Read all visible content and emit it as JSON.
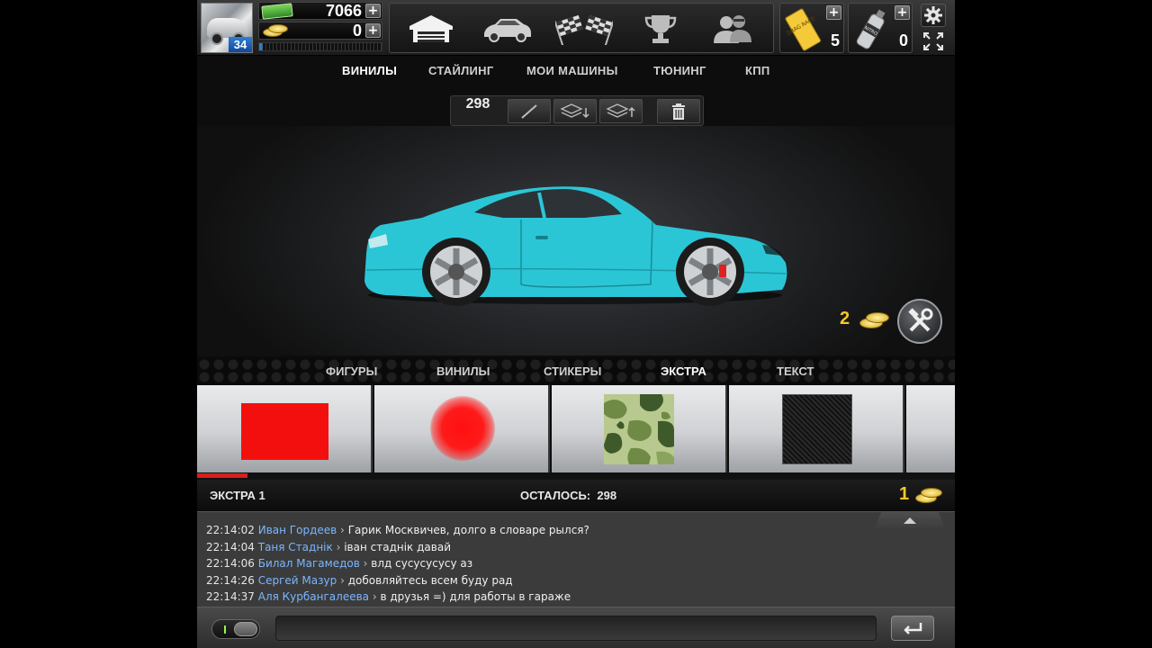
{
  "player": {
    "level": "34",
    "cash": "7066",
    "gold": "0",
    "xp_fraction": 0.03
  },
  "top_nav": [
    {
      "icon": "garage-icon"
    },
    {
      "icon": "car-icon"
    },
    {
      "icon": "race-flags-icon"
    },
    {
      "icon": "trophy-icon"
    },
    {
      "icon": "friends-icon"
    }
  ],
  "resources": {
    "tickets": "5",
    "nitro": "0",
    "ticket_label": "DRAG RACE",
    "nitro_label": "NITRO"
  },
  "main_tabs": [
    {
      "label": "ВИНИЛЫ",
      "active": true
    },
    {
      "label": "СТАЙЛИНГ",
      "active": false
    },
    {
      "label": "МОИ МАШИНЫ",
      "active": false
    },
    {
      "label": "ТЮНИНГ",
      "active": false
    },
    {
      "label": "КПП",
      "active": false
    }
  ],
  "toolbar": {
    "count": "298",
    "tools": [
      "brush-icon",
      "layer-down-icon",
      "layer-up-icon",
      "trash-icon"
    ]
  },
  "stage": {
    "car_color": "#2bc6d6",
    "price": "2"
  },
  "sub_tabs": [
    {
      "label": "ФИГУРЫ",
      "active": false
    },
    {
      "label": "ВИНИЛЫ",
      "active": false
    },
    {
      "label": "СТИКЕРЫ",
      "active": false
    },
    {
      "label": "ЭКСТРА",
      "active": true
    },
    {
      "label": "ТЕКСТ",
      "active": false
    }
  ],
  "carousel": {
    "items": [
      "red-square",
      "red-blur-circle",
      "camo-pattern",
      "carbon-pattern"
    ],
    "scroll_fraction": 0.066
  },
  "info_bar": {
    "selected": "ЭКСТРА 1",
    "remaining": "ОСТАЛОСЬ:  298",
    "price": "1"
  },
  "chat": {
    "messages": [
      {
        "time": "22:14:02",
        "name": "Иван Гордеев",
        "text": "Гарик Москвичев, долго в словаре рылся?"
      },
      {
        "time": "22:14:04",
        "name": "Таня Стаднік",
        "text": "іван стаднік давай"
      },
      {
        "time": "22:14:06",
        "name": "Билал Магамедов",
        "text": "влд сусусусусу аз"
      },
      {
        "time": "22:14:26",
        "name": "Сергей Мазур",
        "text": "добовляйтесь всем буду рад"
      },
      {
        "time": "22:14:37",
        "name": "Аля Курбангалеева",
        "text": "в друзья =) для работы в гараже"
      }
    ],
    "input_value": "",
    "separator": "›"
  },
  "colors": {
    "accent_blue": "#7ab6ff",
    "gold": "#f5c928",
    "progress_red": "#d91d1d"
  }
}
